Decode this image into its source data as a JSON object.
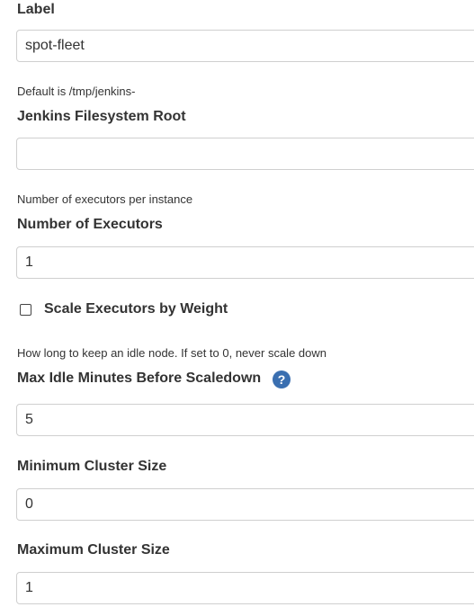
{
  "form": {
    "label": {
      "title": "Label",
      "value": "spot-fleet"
    },
    "fs_root": {
      "description": "Default is /tmp/jenkins-",
      "title": "Jenkins Filesystem Root",
      "value": ""
    },
    "executors": {
      "description": "Number of executors per instance",
      "title": "Number of Executors",
      "value": "1"
    },
    "scale_by_weight": {
      "label": "Scale Executors by Weight",
      "checked": false
    },
    "max_idle": {
      "description": "How long to keep an idle node. If set to 0, never scale down",
      "title": "Max Idle Minutes Before Scaledown",
      "help_icon": "?",
      "value": "5"
    },
    "min_cluster": {
      "title": "Minimum Cluster Size",
      "value": "0"
    },
    "max_cluster": {
      "title": "Maximum Cluster Size",
      "value": "1"
    }
  },
  "colors": {
    "text": "#333333",
    "border": "#cfcfcf",
    "help_icon_bg": "#3a6fb0"
  }
}
